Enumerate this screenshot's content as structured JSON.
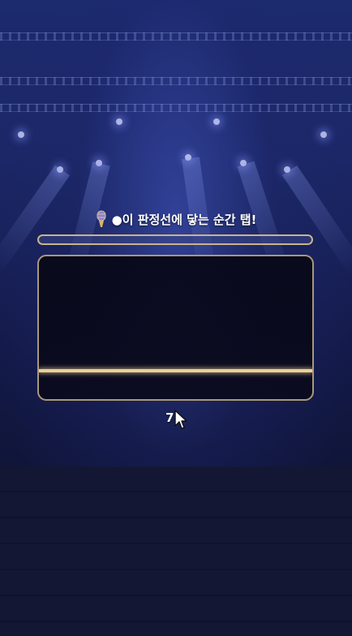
{
  "game": {
    "instruction": "●이 판정선에 닿는 순간 탭!",
    "counter": "7",
    "progress": 0
  },
  "icons": {
    "instruction_icon": "microphone-icon",
    "pointer": "mouse-cursor-icon"
  },
  "colors": {
    "judge_line": "#e9cf98",
    "frame_border": "#a9987a",
    "background": "#1b2766"
  }
}
